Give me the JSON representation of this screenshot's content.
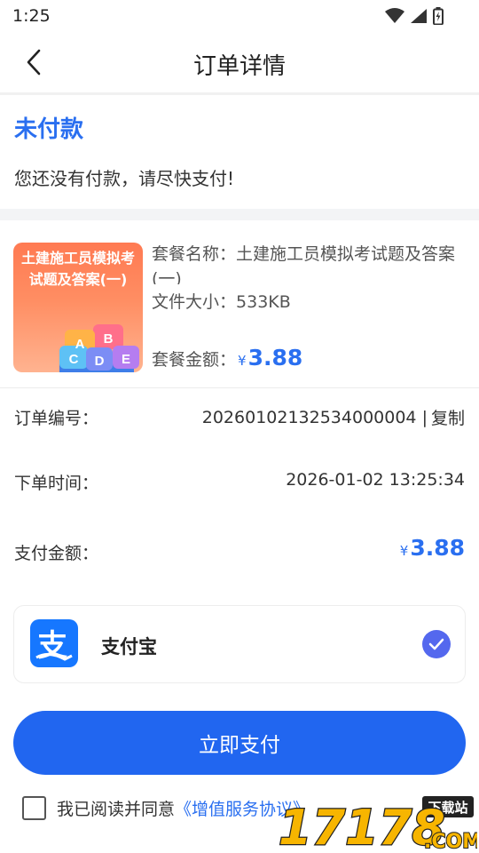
{
  "status_bar": {
    "time": "1:25"
  },
  "header": {
    "title": "订单详情"
  },
  "order_status": {
    "title": "未付款",
    "description": "您还没有付款，请尽快支付!"
  },
  "product": {
    "cover_text": "土建施工员模拟考试题及答案(一)",
    "cover_letters": [
      "A",
      "B",
      "C",
      "D",
      "E"
    ],
    "name_label": "套餐名称：",
    "name": "土建施工员模拟考试题及答案(一)",
    "size_label": "文件大小：",
    "size": "533KB",
    "price_label": "套餐金额：",
    "currency": "¥",
    "price": "3.88"
  },
  "order": {
    "number_label": "订单编号：",
    "number": "20260102132534000004",
    "separator": "|",
    "copy_label": "复制",
    "time_label": "下单时间：",
    "time": "2026-01-02 13:25:34",
    "amount_label": "支付金额：",
    "currency": "¥",
    "amount": "3.88"
  },
  "payment": {
    "method": "支付宝",
    "logo_char": "支",
    "selected": true
  },
  "pay_button": {
    "label": "立即支付"
  },
  "agreement": {
    "text": "我已阅读并同意",
    "link": "《增值服务协议》",
    "checked": false
  },
  "watermark": {
    "number": "17178",
    "tag": "下载站",
    "domain": ".COM"
  },
  "colors": {
    "accent": "#2a6ff0",
    "button": "#2166f0",
    "alipay": "#1677ff",
    "check": "#5468ee",
    "cover_orange": "#ff7a52"
  }
}
